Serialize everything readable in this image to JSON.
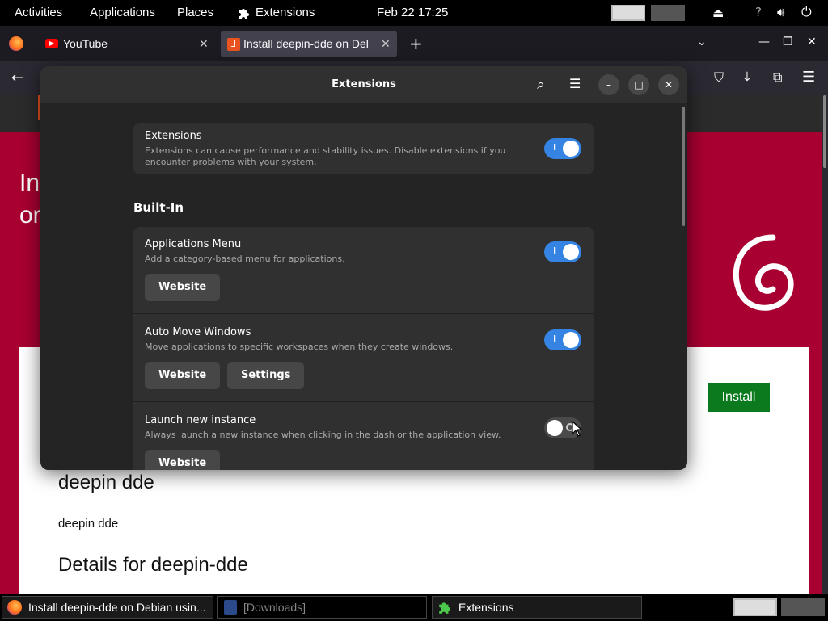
{
  "topbar": {
    "activities": "Activities",
    "applications": "Applications",
    "places": "Places",
    "extensions": "Extensions",
    "clock": "Feb 22  17:25"
  },
  "browser": {
    "tabs": [
      {
        "label": "YouTube"
      },
      {
        "label": "Install deepin-dde on Del"
      }
    ],
    "new_tab": "+"
  },
  "webpage": {
    "heading_fragment_1": "In",
    "heading_fragment_2": "or",
    "install_button": "Install",
    "subheading": "deepin dde",
    "body_text": "deepin dde",
    "details_heading": "Details for deepin-dde"
  },
  "dialog": {
    "title": "Extensions",
    "master": {
      "title": "Extensions",
      "desc_line1": "Extensions can cause performance and stability issues. Disable extensions if you",
      "desc_line2": "encounter problems with your system.",
      "enabled": true
    },
    "section_title": "Built-In",
    "items": [
      {
        "title": "Applications Menu",
        "desc": "Add a category-based menu for applications.",
        "enabled": true,
        "website": "Website"
      },
      {
        "title": "Auto Move Windows",
        "desc": "Move applications to specific workspaces when they create windows.",
        "enabled": true,
        "website": "Website",
        "settings": "Settings"
      },
      {
        "title": "Launch new instance",
        "desc": "Always launch a new instance when clicking in the dash or the application view.",
        "enabled": false,
        "website": "Website"
      }
    ],
    "toggle_on_mark": "I"
  },
  "taskbar": {
    "items": [
      {
        "label": "Install deepin-dde on Debian usin..."
      },
      {
        "label": "[Downloads]"
      },
      {
        "label": "Extensions"
      }
    ]
  },
  "colors": {
    "accent": "#3584e4",
    "page_bg": "#a80030",
    "install_green": "#0b7a1e"
  }
}
